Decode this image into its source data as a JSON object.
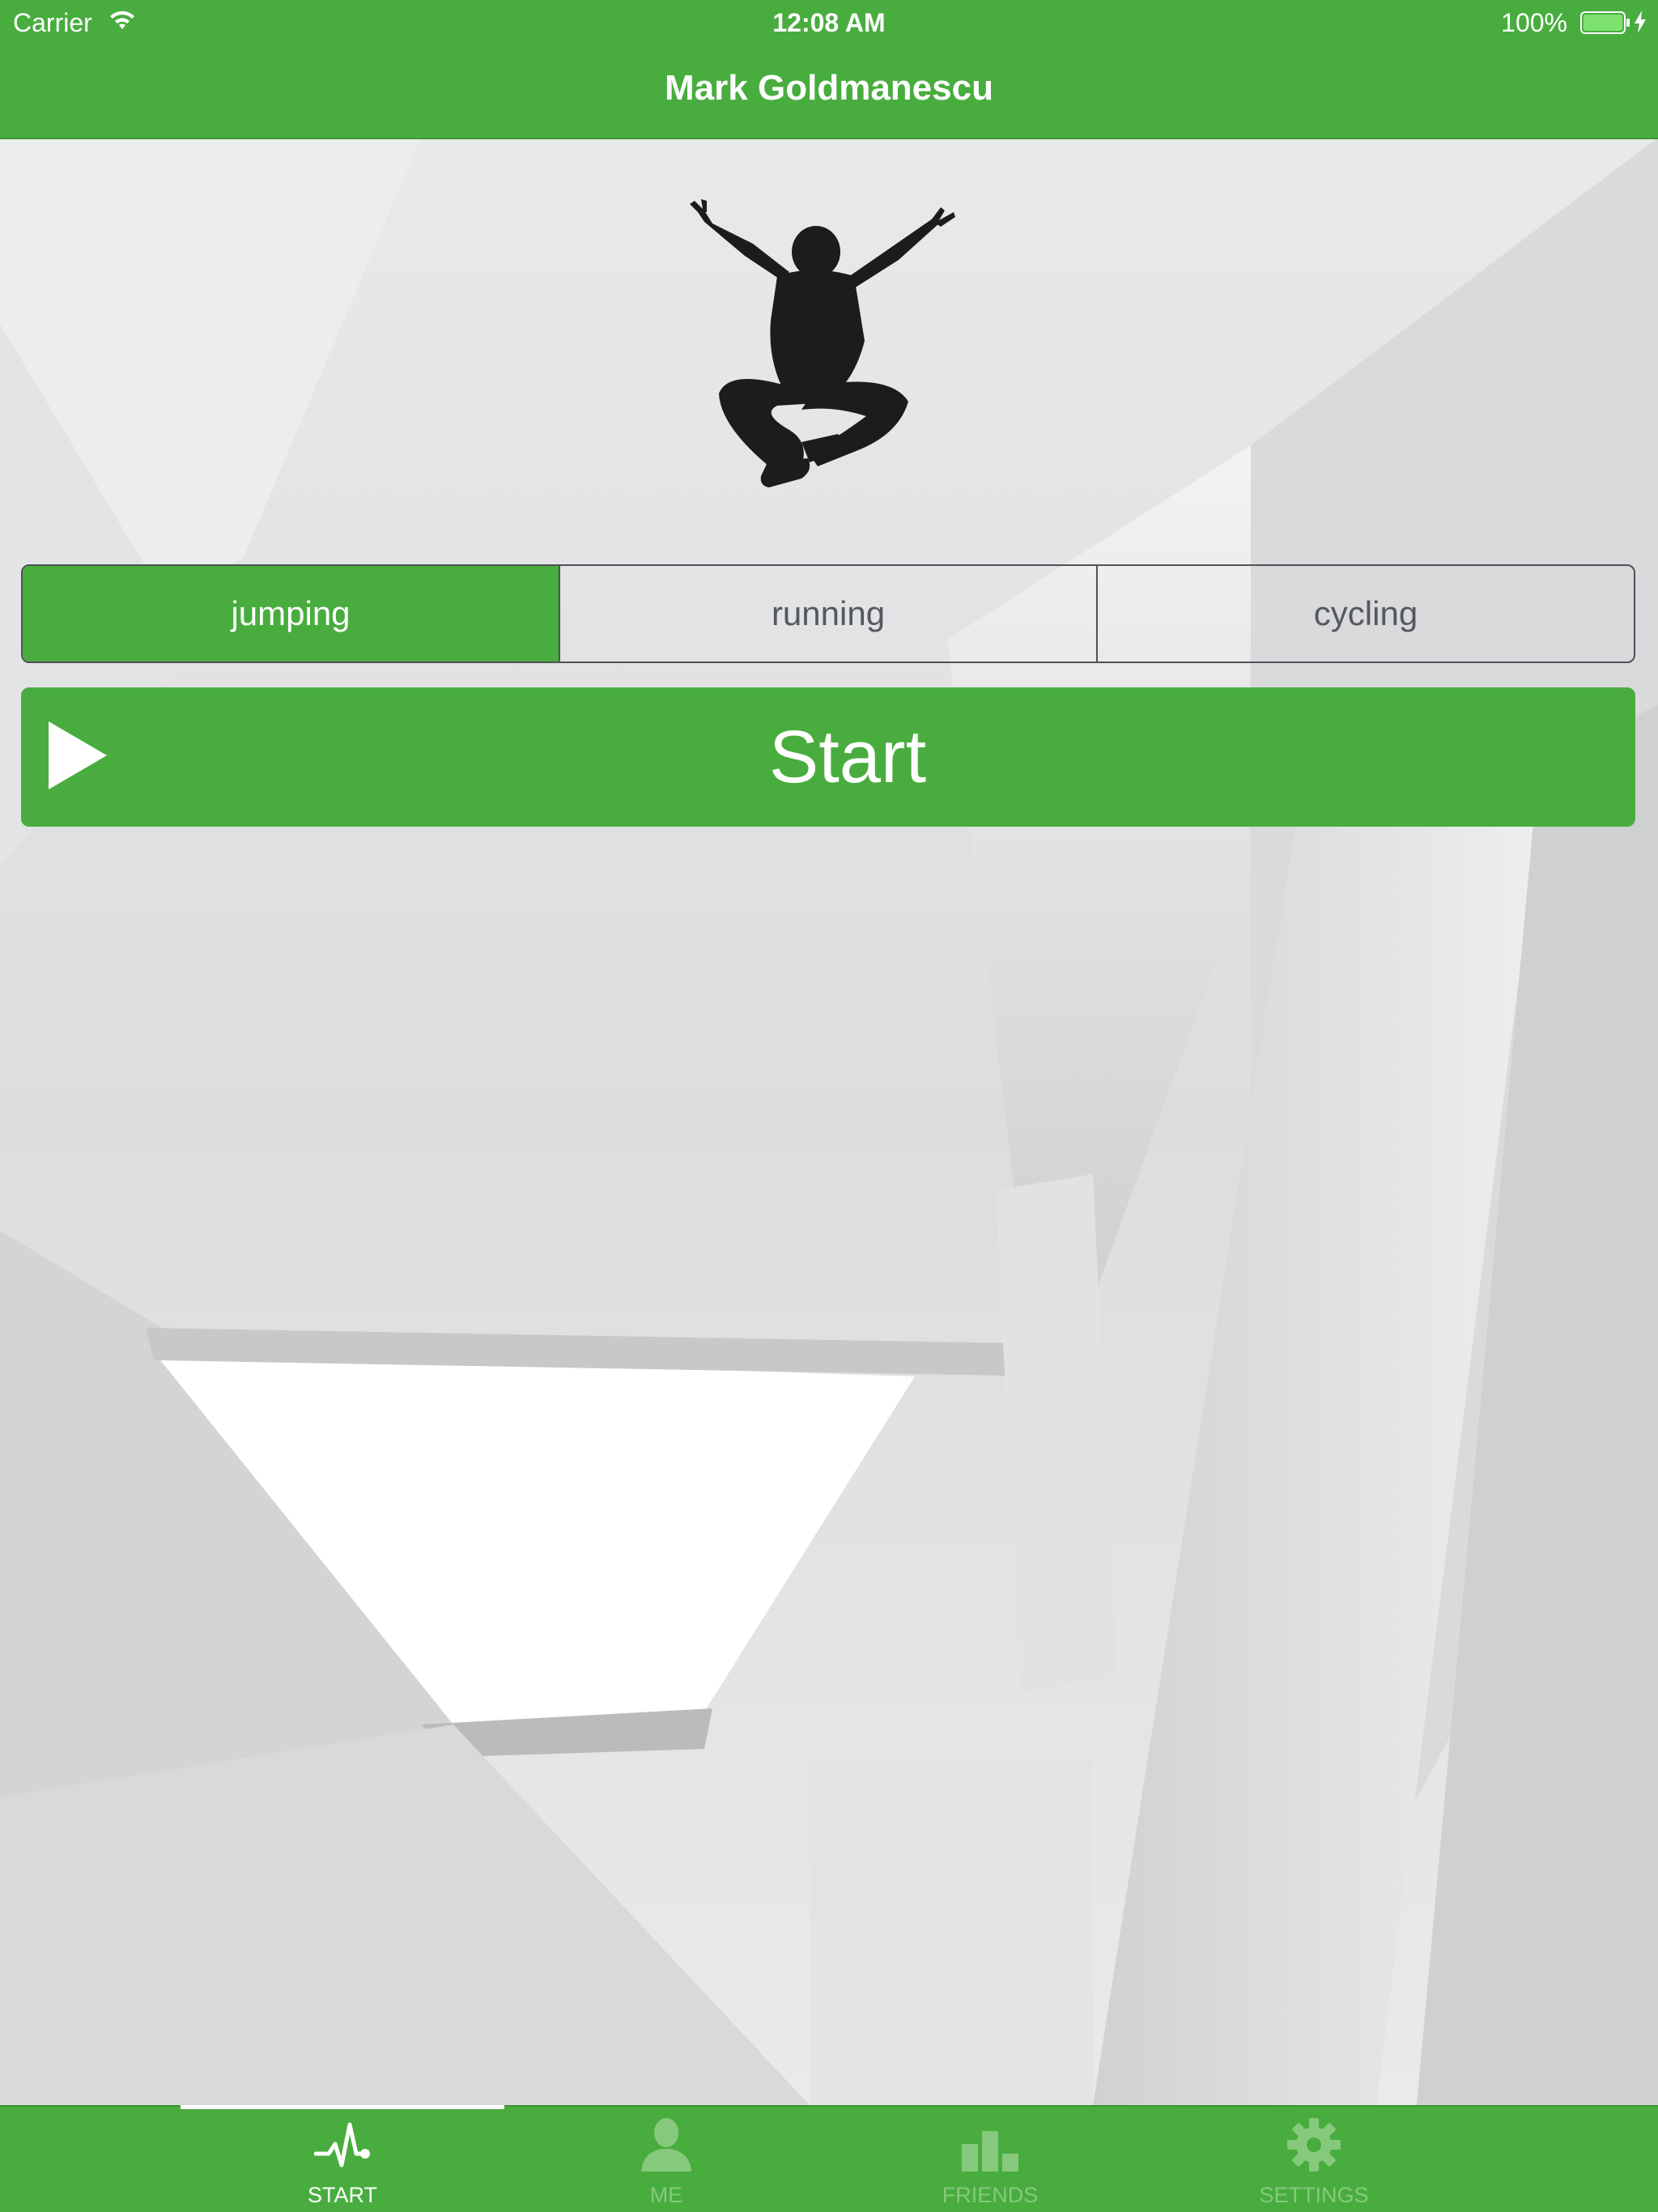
{
  "status_bar": {
    "carrier": "Carrier",
    "time": "12:08 AM",
    "battery": "100%"
  },
  "nav": {
    "title": "Mark Goldmanescu"
  },
  "activity_picker": {
    "options": [
      {
        "label": "jumping",
        "selected": true
      },
      {
        "label": "running",
        "selected": false
      },
      {
        "label": "cycling",
        "selected": false
      }
    ]
  },
  "start_button": {
    "label": "Start",
    "icon": "play-icon"
  },
  "tab_bar": {
    "tabs": [
      {
        "label": "START",
        "icon": "pulse-icon",
        "active": true
      },
      {
        "label": "ME",
        "icon": "person-icon",
        "active": false
      },
      {
        "label": "FRIENDS",
        "icon": "bar-chart-icon",
        "active": false
      },
      {
        "label": "SETTINGS",
        "icon": "gear-icon",
        "active": false
      }
    ]
  },
  "colors": {
    "accent": "#48ad3e",
    "inactive_tab": "#86c97d",
    "text_dark": "#55585c"
  }
}
